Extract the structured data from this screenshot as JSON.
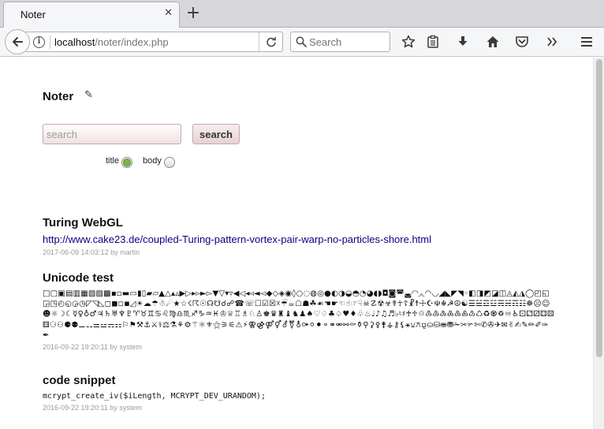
{
  "browser": {
    "tab_title": "Noter",
    "tab_close": "✕",
    "new_tab": "+",
    "url_host": "localhost",
    "url_path": "/noter/index.php",
    "search_placeholder": "Search"
  },
  "app": {
    "title": "Noter",
    "edit_glyph": "✎",
    "search_placeholder": "search",
    "search_button": "search",
    "radio_title_label": "title",
    "radio_body_label": "body"
  },
  "notes": [
    {
      "title": "Turing WebGL",
      "link": "http://www.cake23.de/coupled-Turing-pattern-vortex-pair-warp-no-particles-shore.html",
      "meta": "2017-06-09 14:03:12 by martin"
    },
    {
      "title": "Unicode test",
      "glyphs": "□▢▣▤▥▦▧▨▩▪▫▬▭▮▯▰▱▲△▴▵▶▷▸▹►▻▼▽▾▿◀◁◂◃◄◅◆◇◈◉◊○◌◍◎●◐◑◒◓◔◕◖◗◘◙◚◛◜◝◞◟◠◡◢◣◤◥◦◧◨◩◪◫◬◭◮◯◰◱◲◳◴◵◶◷◸◹◺◻◼◽◾◿☀☁☂☃☄★☆☇☈☉☊☋☌☍☎☏☐☑☒☓☔☕☖☗☘☙☚☛☜☝☞☟☠☡☢☣☤☥☦☧☨☩☪☫☬☭☮☯☰☱☲☳☴☵☶☷☸☹☺☻☼☽☾☿♀♁♂♃♄♅♆♇♈♉♊♋♌♍♎♏♐♑♒♓♔♕♖♗♘♙♚♛♜♝♞♟♠♡♢♣♤♥♦♧♨♩♪♫♬♭♮♯♰♱♲♳♴♵♶♷♸♹♺♻♼♽♾♿⚀⚁⚂⚃⚄⚅⚆⚇⚈⚉⚊⚋⚌⚍⚎⚏⚐⚑⚒⚓⚔⚕⚖⚗⚘⚙⚚⚛⚜⚝⚞⚟⚠⚡⚢⚣⚤⚥⚦⚧⚨⚩⚪⚫⚬⚭⚮⚯⚰⚱⚲⚳⚴⚵⚶⚷⚸⚹⚺⚻⚼⛀⛁⛂⛃✁✂✃✄✆✇✈✉✌✍✎✏✐✑✒",
      "meta": "2016-09-22 19:20:11 by system"
    },
    {
      "title": "code snippet",
      "code": "mcrypt_create_iv($iLength, MCRYPT_DEV_URANDOM);",
      "meta": "2016-09-22 19:20:11 by system"
    }
  ]
}
